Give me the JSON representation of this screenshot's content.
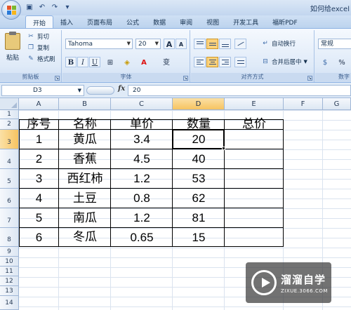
{
  "window": {
    "title": "如何给excel"
  },
  "ribbon": {
    "tabs": [
      "开始",
      "插入",
      "页面布局",
      "公式",
      "数据",
      "审阅",
      "视图",
      "开发工具",
      "福昕PDF"
    ],
    "active_tab": 0,
    "clipboard": {
      "label": "剪贴板",
      "paste": "粘贴",
      "cut": "剪切",
      "copy": "复制",
      "format_painter": "格式刷"
    },
    "font": {
      "label": "字体",
      "font_name": "Tahoma",
      "font_size": "20",
      "bold": "B",
      "italic": "I",
      "underline": "U",
      "grow": "A",
      "shrink": "A",
      "phonetic": "变"
    },
    "alignment": {
      "label": "对齐方式",
      "wrap_text": "自动换行",
      "merge_center": "合并后居中"
    },
    "number": {
      "label": "数字",
      "format": "常规",
      "percent": "%"
    }
  },
  "formula_bar": {
    "name_box": "D3",
    "fx": "fx",
    "content": "20"
  },
  "sheet": {
    "columns": [
      "A",
      "B",
      "C",
      "D",
      "E",
      "F",
      "G"
    ],
    "selected_column": "D",
    "rows": [
      "1",
      "2",
      "3",
      "4",
      "5",
      "6",
      "7",
      "8",
      "9",
      "10",
      "11",
      "12",
      "13",
      "14"
    ],
    "selected_row": "3",
    "header": [
      "序号",
      "名称",
      "单价",
      "数量",
      "总价"
    ],
    "data": [
      [
        "1",
        "黄瓜",
        "3.4",
        "20",
        ""
      ],
      [
        "2",
        "香蕉",
        "4.5",
        "40",
        ""
      ],
      [
        "3",
        "西红柿",
        "1.2",
        "53",
        ""
      ],
      [
        "4",
        "土豆",
        "0.8",
        "62",
        ""
      ],
      [
        "5",
        "南瓜",
        "1.2",
        "81",
        ""
      ],
      [
        "6",
        "冬瓜",
        "0.65",
        "15",
        ""
      ]
    ]
  },
  "watermark": {
    "title": "溜溜自学",
    "url": "ZIXUE.3066.COM"
  }
}
